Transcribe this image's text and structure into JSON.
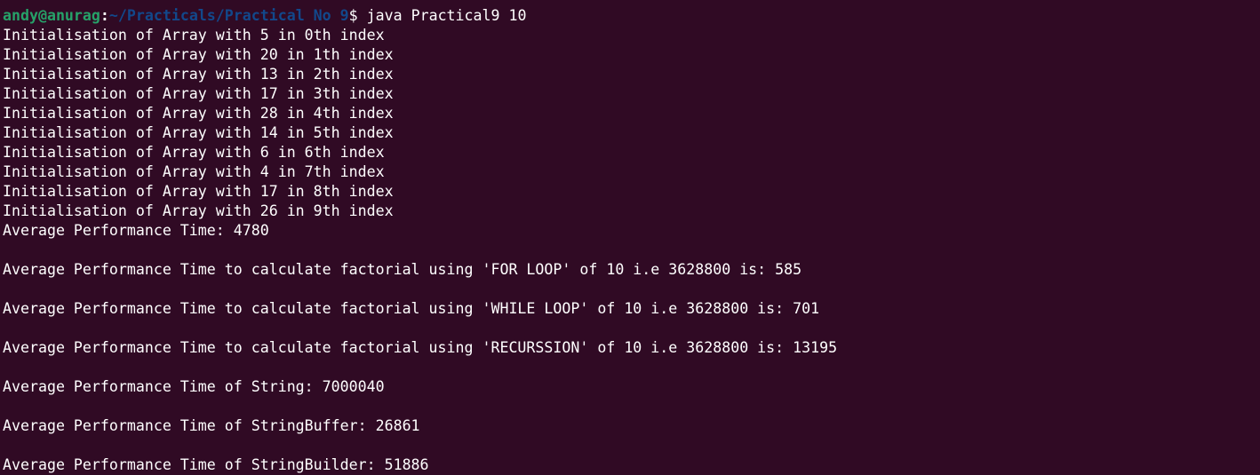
{
  "prompt": {
    "user_host": "andy@anurag",
    "separator": ":",
    "path": "~/Practicals/Practical No 9",
    "symbol": "$ ",
    "command": "java Practical9 10"
  },
  "output": [
    "Initialisation of Array with 5 in 0th index",
    "Initialisation of Array with 20 in 1th index",
    "Initialisation of Array with 13 in 2th index",
    "Initialisation of Array with 17 in 3th index",
    "Initialisation of Array with 28 in 4th index",
    "Initialisation of Array with 14 in 5th index",
    "Initialisation of Array with 6 in 6th index",
    "Initialisation of Array with 4 in 7th index",
    "Initialisation of Array with 17 in 8th index",
    "Initialisation of Array with 26 in 9th index",
    "Average Performance Time: 4780",
    "",
    "Average Performance Time to calculate factorial using 'FOR LOOP' of 10 i.e 3628800 is: 585",
    "",
    "Average Performance Time to calculate factorial using 'WHILE LOOP' of 10 i.e 3628800 is: 701",
    "",
    "Average Performance Time to calculate factorial using 'RECURSSION' of 10 i.e 3628800 is: 13195",
    "",
    "Average Performance Time of String: 7000040",
    "",
    "Average Performance Time of StringBuffer: 26861",
    "",
    "Average Performance Time of StringBuilder: 51886"
  ],
  "colors": {
    "background": "#300a24",
    "text": "#ffffff",
    "user_host": "#26a269",
    "path": "#12488b"
  }
}
